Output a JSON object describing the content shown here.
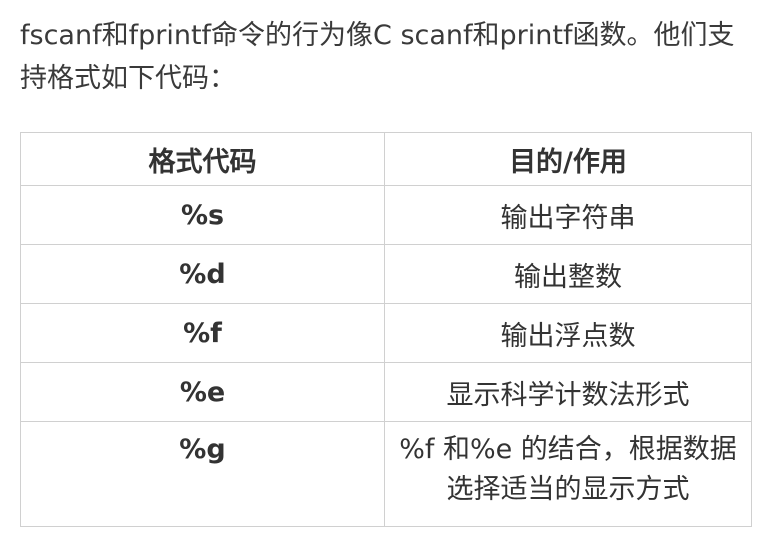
{
  "intro": {
    "text": "fscanf和fprintf命令的行为像C scanf和printf函数。他们支持格式如下代码："
  },
  "table": {
    "headers": [
      "格式代码",
      "目的/作用"
    ],
    "rows": [
      {
        "code": "%s",
        "purpose": "输出字符串"
      },
      {
        "code": "%d",
        "purpose": "输出整数"
      },
      {
        "code": "%f",
        "purpose": "输出浮点数"
      },
      {
        "code": "%e",
        "purpose": "显示科学计数法形式"
      },
      {
        "code": "%g",
        "purpose": "%f 和%e 的结合，根据数据选择适当的显示方式"
      }
    ]
  }
}
